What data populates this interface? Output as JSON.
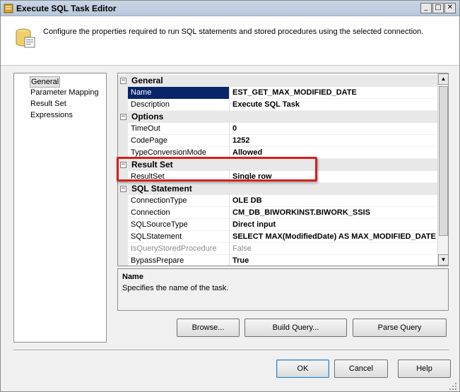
{
  "window": {
    "title": "Execute SQL Task Editor",
    "min": "_",
    "max": "□",
    "close": "✕"
  },
  "header": {
    "text": "Configure the properties required to run SQL statements and stored procedures using the selected connection."
  },
  "nav": {
    "items": [
      "General",
      "Parameter Mapping",
      "Result Set",
      "Expressions"
    ],
    "selected": "General"
  },
  "grid": {
    "categories": [
      {
        "label": "General",
        "toggle": "−",
        "rows": [
          {
            "name": "Name",
            "value": "EST_GET_MAX_MODIFIED_DATE"
          },
          {
            "name": "Description",
            "value": "Execute SQL Task"
          }
        ]
      },
      {
        "label": "Options",
        "toggle": "−",
        "rows": [
          {
            "name": "TimeOut",
            "value": "0"
          },
          {
            "name": "CodePage",
            "value": "1252"
          },
          {
            "name": "TypeConversionMode",
            "value": "Allowed"
          }
        ]
      },
      {
        "label": "Result Set",
        "toggle": "−",
        "rows": [
          {
            "name": "ResultSet",
            "value": "Single row"
          }
        ]
      },
      {
        "label": "SQL Statement",
        "toggle": "−",
        "rows": [
          {
            "name": "ConnectionType",
            "value": "OLE DB"
          },
          {
            "name": "Connection",
            "value": "CM_DB_BIWORKINST.BIWORK_SSIS"
          },
          {
            "name": "SQLSourceType",
            "value": "Direct input"
          },
          {
            "name": "SQLStatement",
            "value": "SELECT MAX(ModifiedDate) AS MAX_MODIFIED_DATE"
          },
          {
            "name": "IsQueryStoredProcedure",
            "value": "False",
            "disabled": true
          },
          {
            "name": "BypassPrepare",
            "value": "True"
          }
        ]
      }
    ],
    "selected_property": "Name"
  },
  "description": {
    "title": "Name",
    "text": "Specifies the name of the task."
  },
  "actions": {
    "browse": "Browse...",
    "build_query": "Build Query...",
    "parse_query": "Parse Query"
  },
  "footer": {
    "ok": "OK",
    "cancel": "Cancel",
    "help": "Help"
  },
  "colors": {
    "selection": "#0a246a",
    "highlight_box": "#d4201e"
  },
  "icons": {
    "title": "database-task-icon",
    "header": "database-task-icon"
  }
}
